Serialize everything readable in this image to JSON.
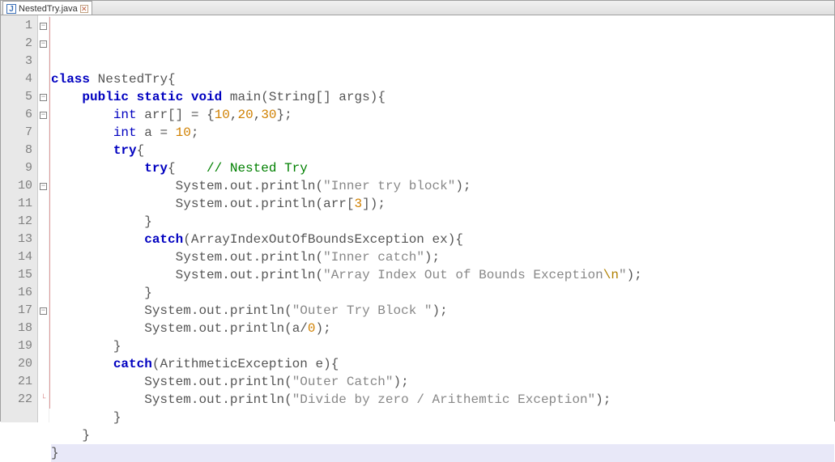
{
  "tab": {
    "title": "NestedTry.java"
  },
  "gutter": {
    "count": 22
  },
  "fold_rows": {
    "1": "box",
    "2": "box",
    "5": "box",
    "6": "box",
    "10": "box",
    "17": "box",
    "22": "end"
  },
  "code": {
    "lines": [
      {
        "indent": "",
        "tokens": [
          {
            "t": "kw",
            "v": "class"
          },
          {
            "t": "sp",
            "v": " "
          },
          {
            "t": "ident",
            "v": "NestedTry"
          },
          {
            "t": "punc",
            "v": "{"
          }
        ]
      },
      {
        "indent": "    ",
        "tokens": [
          {
            "t": "kw",
            "v": "public"
          },
          {
            "t": "sp",
            "v": " "
          },
          {
            "t": "kw",
            "v": "static"
          },
          {
            "t": "sp",
            "v": " "
          },
          {
            "t": "kw",
            "v": "void"
          },
          {
            "t": "sp",
            "v": " "
          },
          {
            "t": "ident",
            "v": "main"
          },
          {
            "t": "punc",
            "v": "("
          },
          {
            "t": "ident",
            "v": "String"
          },
          {
            "t": "punc",
            "v": "[]"
          },
          {
            "t": "sp",
            "v": " "
          },
          {
            "t": "ident",
            "v": "args"
          },
          {
            "t": "punc",
            "v": ")"
          },
          {
            "t": "punc",
            "v": "{"
          }
        ]
      },
      {
        "indent": "        ",
        "tokens": [
          {
            "t": "type",
            "v": "int"
          },
          {
            "t": "sp",
            "v": " "
          },
          {
            "t": "ident",
            "v": "arr"
          },
          {
            "t": "punc",
            "v": "[]"
          },
          {
            "t": "sp",
            "v": " "
          },
          {
            "t": "op",
            "v": "="
          },
          {
            "t": "sp",
            "v": " "
          },
          {
            "t": "punc",
            "v": "{"
          },
          {
            "t": "num",
            "v": "10"
          },
          {
            "t": "punc",
            "v": ","
          },
          {
            "t": "num",
            "v": "20"
          },
          {
            "t": "punc",
            "v": ","
          },
          {
            "t": "num",
            "v": "30"
          },
          {
            "t": "punc",
            "v": "};"
          }
        ]
      },
      {
        "indent": "        ",
        "tokens": [
          {
            "t": "type",
            "v": "int"
          },
          {
            "t": "sp",
            "v": " "
          },
          {
            "t": "ident",
            "v": "a"
          },
          {
            "t": "sp",
            "v": " "
          },
          {
            "t": "op",
            "v": "="
          },
          {
            "t": "sp",
            "v": " "
          },
          {
            "t": "num",
            "v": "10"
          },
          {
            "t": "punc",
            "v": ";"
          }
        ]
      },
      {
        "indent": "        ",
        "tokens": [
          {
            "t": "kw",
            "v": "try"
          },
          {
            "t": "punc",
            "v": "{"
          }
        ]
      },
      {
        "indent": "            ",
        "tokens": [
          {
            "t": "kw",
            "v": "try"
          },
          {
            "t": "punc",
            "v": "{"
          },
          {
            "t": "sp",
            "v": "    "
          },
          {
            "t": "comment",
            "v": "// Nested Try"
          }
        ]
      },
      {
        "indent": "                ",
        "tokens": [
          {
            "t": "ident",
            "v": "System"
          },
          {
            "t": "punc",
            "v": "."
          },
          {
            "t": "ident",
            "v": "out"
          },
          {
            "t": "punc",
            "v": "."
          },
          {
            "t": "ident",
            "v": "println"
          },
          {
            "t": "punc",
            "v": "("
          },
          {
            "t": "str",
            "v": "\"Inner try block\""
          },
          {
            "t": "punc",
            "v": ");"
          }
        ]
      },
      {
        "indent": "                ",
        "tokens": [
          {
            "t": "ident",
            "v": "System"
          },
          {
            "t": "punc",
            "v": "."
          },
          {
            "t": "ident",
            "v": "out"
          },
          {
            "t": "punc",
            "v": "."
          },
          {
            "t": "ident",
            "v": "println"
          },
          {
            "t": "punc",
            "v": "("
          },
          {
            "t": "ident",
            "v": "arr"
          },
          {
            "t": "punc",
            "v": "["
          },
          {
            "t": "num",
            "v": "3"
          },
          {
            "t": "punc",
            "v": "]);"
          }
        ]
      },
      {
        "indent": "            ",
        "tokens": [
          {
            "t": "punc",
            "v": "}"
          }
        ]
      },
      {
        "indent": "            ",
        "tokens": [
          {
            "t": "kw",
            "v": "catch"
          },
          {
            "t": "punc",
            "v": "("
          },
          {
            "t": "ident",
            "v": "ArrayIndexOutOfBoundsException"
          },
          {
            "t": "sp",
            "v": " "
          },
          {
            "t": "ident",
            "v": "ex"
          },
          {
            "t": "punc",
            "v": ")"
          },
          {
            "t": "punc",
            "v": "{"
          }
        ]
      },
      {
        "indent": "                ",
        "tokens": [
          {
            "t": "ident",
            "v": "System"
          },
          {
            "t": "punc",
            "v": "."
          },
          {
            "t": "ident",
            "v": "out"
          },
          {
            "t": "punc",
            "v": "."
          },
          {
            "t": "ident",
            "v": "println"
          },
          {
            "t": "punc",
            "v": "("
          },
          {
            "t": "str",
            "v": "\"Inner catch\""
          },
          {
            "t": "punc",
            "v": ");"
          }
        ]
      },
      {
        "indent": "                ",
        "tokens": [
          {
            "t": "ident",
            "v": "System"
          },
          {
            "t": "punc",
            "v": "."
          },
          {
            "t": "ident",
            "v": "out"
          },
          {
            "t": "punc",
            "v": "."
          },
          {
            "t": "ident",
            "v": "println"
          },
          {
            "t": "punc",
            "v": "("
          },
          {
            "t": "str",
            "v": "\"Array Index Out of Bounds Exception"
          },
          {
            "t": "esc",
            "v": "\\n"
          },
          {
            "t": "str",
            "v": "\""
          },
          {
            "t": "punc",
            "v": ");"
          }
        ]
      },
      {
        "indent": "            ",
        "tokens": [
          {
            "t": "punc",
            "v": "}"
          }
        ]
      },
      {
        "indent": "            ",
        "tokens": [
          {
            "t": "ident",
            "v": "System"
          },
          {
            "t": "punc",
            "v": "."
          },
          {
            "t": "ident",
            "v": "out"
          },
          {
            "t": "punc",
            "v": "."
          },
          {
            "t": "ident",
            "v": "println"
          },
          {
            "t": "punc",
            "v": "("
          },
          {
            "t": "str",
            "v": "\"Outer Try Block \""
          },
          {
            "t": "punc",
            "v": ");"
          }
        ]
      },
      {
        "indent": "            ",
        "tokens": [
          {
            "t": "ident",
            "v": "System"
          },
          {
            "t": "punc",
            "v": "."
          },
          {
            "t": "ident",
            "v": "out"
          },
          {
            "t": "punc",
            "v": "."
          },
          {
            "t": "ident",
            "v": "println"
          },
          {
            "t": "punc",
            "v": "("
          },
          {
            "t": "ident",
            "v": "a"
          },
          {
            "t": "op",
            "v": "/"
          },
          {
            "t": "num",
            "v": "0"
          },
          {
            "t": "punc",
            "v": ");"
          }
        ]
      },
      {
        "indent": "        ",
        "tokens": [
          {
            "t": "punc",
            "v": "}"
          }
        ]
      },
      {
        "indent": "        ",
        "tokens": [
          {
            "t": "kw",
            "v": "catch"
          },
          {
            "t": "punc",
            "v": "("
          },
          {
            "t": "ident",
            "v": "ArithmeticException"
          },
          {
            "t": "sp",
            "v": " "
          },
          {
            "t": "ident",
            "v": "e"
          },
          {
            "t": "punc",
            "v": ")"
          },
          {
            "t": "punc",
            "v": "{"
          }
        ]
      },
      {
        "indent": "            ",
        "tokens": [
          {
            "t": "ident",
            "v": "System"
          },
          {
            "t": "punc",
            "v": "."
          },
          {
            "t": "ident",
            "v": "out"
          },
          {
            "t": "punc",
            "v": "."
          },
          {
            "t": "ident",
            "v": "println"
          },
          {
            "t": "punc",
            "v": "("
          },
          {
            "t": "str",
            "v": "\"Outer Catch\""
          },
          {
            "t": "punc",
            "v": ");"
          }
        ]
      },
      {
        "indent": "            ",
        "tokens": [
          {
            "t": "ident",
            "v": "System"
          },
          {
            "t": "punc",
            "v": "."
          },
          {
            "t": "ident",
            "v": "out"
          },
          {
            "t": "punc",
            "v": "."
          },
          {
            "t": "ident",
            "v": "println"
          },
          {
            "t": "punc",
            "v": "("
          },
          {
            "t": "str",
            "v": "\"Divide by zero / Arithemtic Exception\""
          },
          {
            "t": "punc",
            "v": ");"
          }
        ]
      },
      {
        "indent": "        ",
        "tokens": [
          {
            "t": "punc",
            "v": "}"
          }
        ]
      },
      {
        "indent": "    ",
        "tokens": [
          {
            "t": "punc",
            "v": "}"
          }
        ]
      },
      {
        "indent": "",
        "tokens": [
          {
            "t": "punc",
            "v": "}"
          }
        ],
        "highlight": true
      }
    ]
  }
}
